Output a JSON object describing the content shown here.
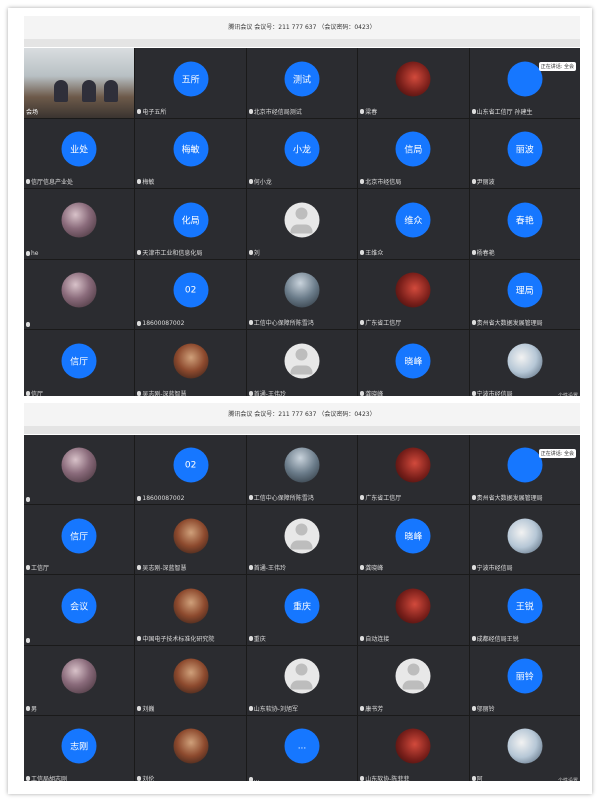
{
  "colors": {
    "accent": "#1677ff",
    "tile_bg": "#2b2c30"
  },
  "top": {
    "title": "腾讯会议 会议号：211 777 637 （会议密码：0423）",
    "speaking_badge": "正在讲话: 全会",
    "footer": "个性设置",
    "tiles": [
      {
        "type": "venue",
        "name": "会场"
      },
      {
        "type": "blue",
        "avatar": "五所",
        "name": "电子五所"
      },
      {
        "type": "blue",
        "avatar": "测试",
        "name": "北京市经信局测试"
      },
      {
        "type": "photo",
        "avatar": "",
        "name": "梁春"
      },
      {
        "type": "blue",
        "avatar": "",
        "name": "山东省工信厅 孙建生"
      },
      {
        "type": "blue",
        "avatar": "业处",
        "name": "信厅信息产业处"
      },
      {
        "type": "blue",
        "avatar": "梅敏",
        "name": "梅敏"
      },
      {
        "type": "blue",
        "avatar": "小龙",
        "name": "何小龙"
      },
      {
        "type": "blue",
        "avatar": "信局",
        "name": "北京市经信局"
      },
      {
        "type": "blue",
        "avatar": "丽波",
        "name": "尹丽波"
      },
      {
        "type": "photo",
        "avatar": "",
        "name": "he"
      },
      {
        "type": "blue",
        "avatar": "化局",
        "name": "天津市工业和信息化局"
      },
      {
        "type": "gray",
        "avatar": "",
        "name": "刘"
      },
      {
        "type": "blue",
        "avatar": "维众",
        "name": "王维众"
      },
      {
        "type": "blue",
        "avatar": "春艳",
        "name": "杨春艳"
      },
      {
        "type": "photo",
        "avatar": "",
        "name": ""
      },
      {
        "type": "blue",
        "avatar": "02",
        "name": "18600087002"
      },
      {
        "type": "photo",
        "avatar": "",
        "name": "工信中心保障所陈雪鸿"
      },
      {
        "type": "photo",
        "avatar": "",
        "name": "广东省工信厅"
      },
      {
        "type": "blue",
        "avatar": "理局",
        "name": "贵州省大数据发展管理局"
      },
      {
        "type": "blue",
        "avatar": "信厅",
        "name": "信厅"
      },
      {
        "type": "photo",
        "avatar": "",
        "name": "吴志刚-深蓝智慧"
      },
      {
        "type": "gray",
        "avatar": "",
        "name": "首通-王伟玲"
      },
      {
        "type": "blue",
        "avatar": "晓峰",
        "name": "龚晓峰"
      },
      {
        "type": "photo",
        "avatar": "",
        "name": "宁波市经信局"
      }
    ]
  },
  "bottom": {
    "title": "腾讯会议 会议号：211 777 637 （会议密码：0423）",
    "speaking_badge": "正在讲话: 全会",
    "footer": "个性设置",
    "tiles": [
      {
        "type": "photo",
        "avatar": "",
        "name": ""
      },
      {
        "type": "blue",
        "avatar": "02",
        "name": "18600087002"
      },
      {
        "type": "photo",
        "avatar": "",
        "name": "工信中心保障所陈雪鸿"
      },
      {
        "type": "photo",
        "avatar": "",
        "name": "广东省工信厅"
      },
      {
        "type": "blue",
        "avatar": "",
        "name": "贵州省大数据发展管理局"
      },
      {
        "type": "blue",
        "avatar": "信厅",
        "name": "工信厅"
      },
      {
        "type": "photo",
        "avatar": "",
        "name": "吴志刚-深蓝智慧"
      },
      {
        "type": "gray",
        "avatar": "",
        "name": "首通-王伟玲"
      },
      {
        "type": "blue",
        "avatar": "晓峰",
        "name": "龚晓峰"
      },
      {
        "type": "photo",
        "avatar": "",
        "name": "宁波市经信局"
      },
      {
        "type": "blue",
        "avatar": "会议",
        "name": ""
      },
      {
        "type": "photo",
        "avatar": "",
        "name": "中国电子技术标准化研究院"
      },
      {
        "type": "blue",
        "avatar": "重庆",
        "name": "重庆"
      },
      {
        "type": "photo",
        "avatar": "",
        "name": "自动连接"
      },
      {
        "type": "blue",
        "avatar": "王锐",
        "name": "成都经信局王锐"
      },
      {
        "type": "photo",
        "avatar": "",
        "name": "男"
      },
      {
        "type": "photo",
        "avatar": "",
        "name": "刘巍"
      },
      {
        "type": "gray",
        "avatar": "",
        "name": "山东软协-刘旭军"
      },
      {
        "type": "gray",
        "avatar": "",
        "name": "康书芳"
      },
      {
        "type": "blue",
        "avatar": "丽铃",
        "name": "邬丽铃"
      },
      {
        "type": "blue",
        "avatar": "志刚",
        "name": "工信局胡志刚"
      },
      {
        "type": "photo",
        "avatar": "",
        "name": "刘伦"
      },
      {
        "type": "blue",
        "avatar": "...",
        "name": "..."
      },
      {
        "type": "photo",
        "avatar": "",
        "name": "山东软协-陈菲菲"
      },
      {
        "type": "photo",
        "avatar": "",
        "name": "阿"
      }
    ]
  }
}
